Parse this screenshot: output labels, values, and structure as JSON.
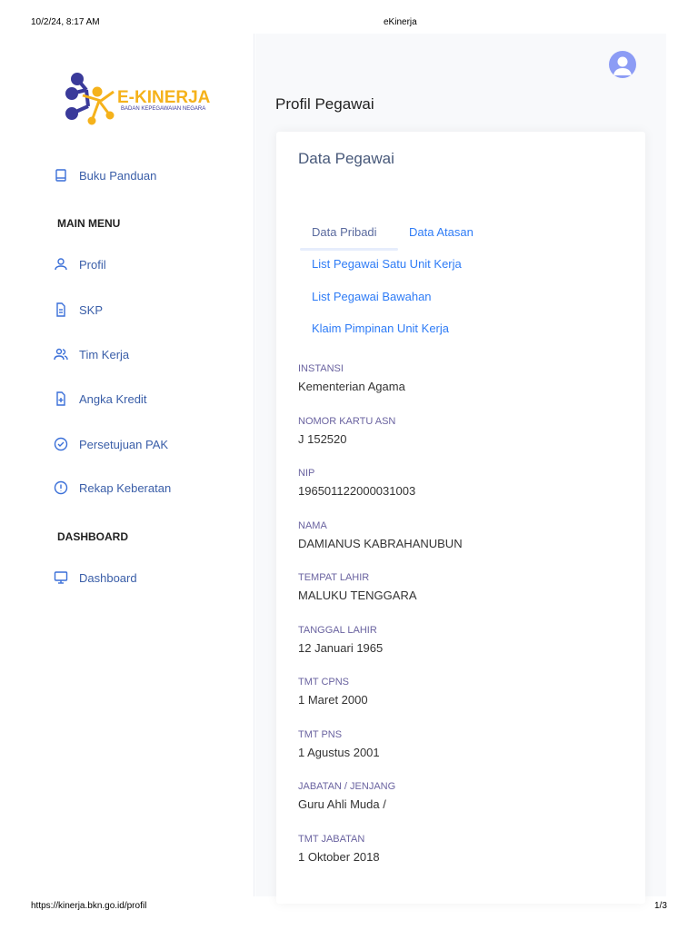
{
  "print_header": {
    "datetime": "10/2/24, 8:17 AM",
    "title": "eKinerja"
  },
  "print_footer": {
    "url": "https://kinerja.bkn.go.id/profil",
    "page": "1/3"
  },
  "logo": {
    "name": "E-KINERJA",
    "subtitle": "BADAN KEPEGAWAIAN NEGARA"
  },
  "sidebar": {
    "guide": {
      "label": "Buku Panduan",
      "icon": "book-icon"
    },
    "main_menu_title": "MAIN MENU",
    "main_menu": [
      {
        "label": "Profil",
        "icon": "user-icon"
      },
      {
        "label": "SKP",
        "icon": "file-icon"
      },
      {
        "label": "Tim Kerja",
        "icon": "users-icon"
      },
      {
        "label": "Angka Kredit",
        "icon": "file-plus-icon"
      },
      {
        "label": "Persetujuan PAK",
        "icon": "check-circle-icon"
      },
      {
        "label": "Rekap Keberatan",
        "icon": "alert-circle-icon"
      }
    ],
    "dashboard_title": "DASHBOARD",
    "dashboard": [
      {
        "label": "Dashboard",
        "icon": "monitor-icon"
      }
    ]
  },
  "main": {
    "page_title": "Profil Pegawai",
    "card_title": "Data Pegawai",
    "tabs": [
      "Data Pribadi",
      "Data Atasan",
      "List Pegawai Satu Unit Kerja",
      "List Pegawai Bawahan",
      "Klaim Pimpinan Unit Kerja"
    ],
    "fields": [
      {
        "label": "INSTANSI",
        "value": "Kementerian Agama"
      },
      {
        "label": "NOMOR KARTU ASN",
        "value": "J 152520"
      },
      {
        "label": "NIP",
        "value": "196501122000031003"
      },
      {
        "label": "NAMA",
        "value": "DAMIANUS KABRAHANUBUN"
      },
      {
        "label": "TEMPAT LAHIR",
        "value": "MALUKU TENGGARA"
      },
      {
        "label": "TANGGAL LAHIR",
        "value": "12 Januari 1965"
      },
      {
        "label": "TMT CPNS",
        "value": "1 Maret 2000"
      },
      {
        "label": "TMT PNS",
        "value": "1 Agustus 2001"
      },
      {
        "label": "JABATAN / JENJANG",
        "value": "Guru Ahli Muda /"
      },
      {
        "label": "TMT JABATAN",
        "value": "1 Oktober 2018"
      }
    ]
  }
}
